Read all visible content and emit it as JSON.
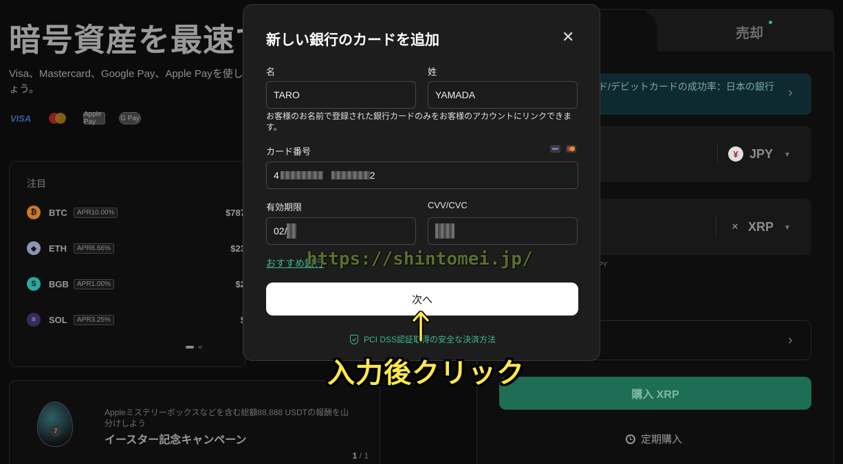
{
  "hero": {
    "title": "暗号資産を最速で",
    "subtitle": "Visa、Mastercard、Google Pay、Apple Payを使しょう。",
    "payment_logos": [
      "VISA",
      "Mastercard",
      "Apple Pay",
      "G Pay"
    ]
  },
  "watchlist": {
    "title": "注目",
    "coins": [
      {
        "symbol": "BTC",
        "apr": "APR10.00%",
        "price": "$787",
        "color": "#c9792a",
        "glyph": "₿"
      },
      {
        "symbol": "ETH",
        "apr": "APR8.66%",
        "price": "$23",
        "color": "#8d93b3",
        "glyph": "◆"
      },
      {
        "symbol": "BGB",
        "apr": "APR1.00%",
        "price": "$2",
        "color": "#2aa7a0",
        "glyph": "S"
      },
      {
        "symbol": "SOL",
        "apr": "APR3.25%",
        "price": "$",
        "color": "#5a3fa0",
        "glyph": "≡"
      }
    ]
  },
  "promo": {
    "description": "Appleミステリーボックスなどを含む総額88,888 USDTの報酬を山分けしよう",
    "title": "イースター記念キャンペーン",
    "page_current": "1",
    "page_total": "/ 1"
  },
  "trade": {
    "sell_tab": "売却",
    "notice": "ド/デビットカードの成功率：日本の銀行",
    "spend_currency": "JPY",
    "spend_currency_glyph": "¥",
    "receive_currency": "XRP",
    "receive_currency_glyph": "✕",
    "tiny_text": "PY",
    "buy_button": "購入 XRP",
    "recurring": "定期購入"
  },
  "modal": {
    "title": "新しい銀行のカードを追加",
    "close": "✕",
    "first_name_label": "名",
    "first_name_value": "TARO",
    "last_name_label": "姓",
    "last_name_value": "YAMADA",
    "hint": "お客様のお名前で登録された銀行カードのみをお客様のアカウントにリンクできます。",
    "card_number_label": "カード番号",
    "card_number_start": "4",
    "card_number_end": "2",
    "expiry_label": "有効期限",
    "expiry_value": "02/",
    "cvv_label": "CVV/CVC",
    "recommend_link": "おすすめ銀行",
    "next_button": "次へ",
    "pci_text": "PCI DSS認証取得の安全な決済方法"
  },
  "annotation": {
    "watermark": "https://shintomei.jp/",
    "instruction": "入力後クリック",
    "arrow": "↑"
  }
}
